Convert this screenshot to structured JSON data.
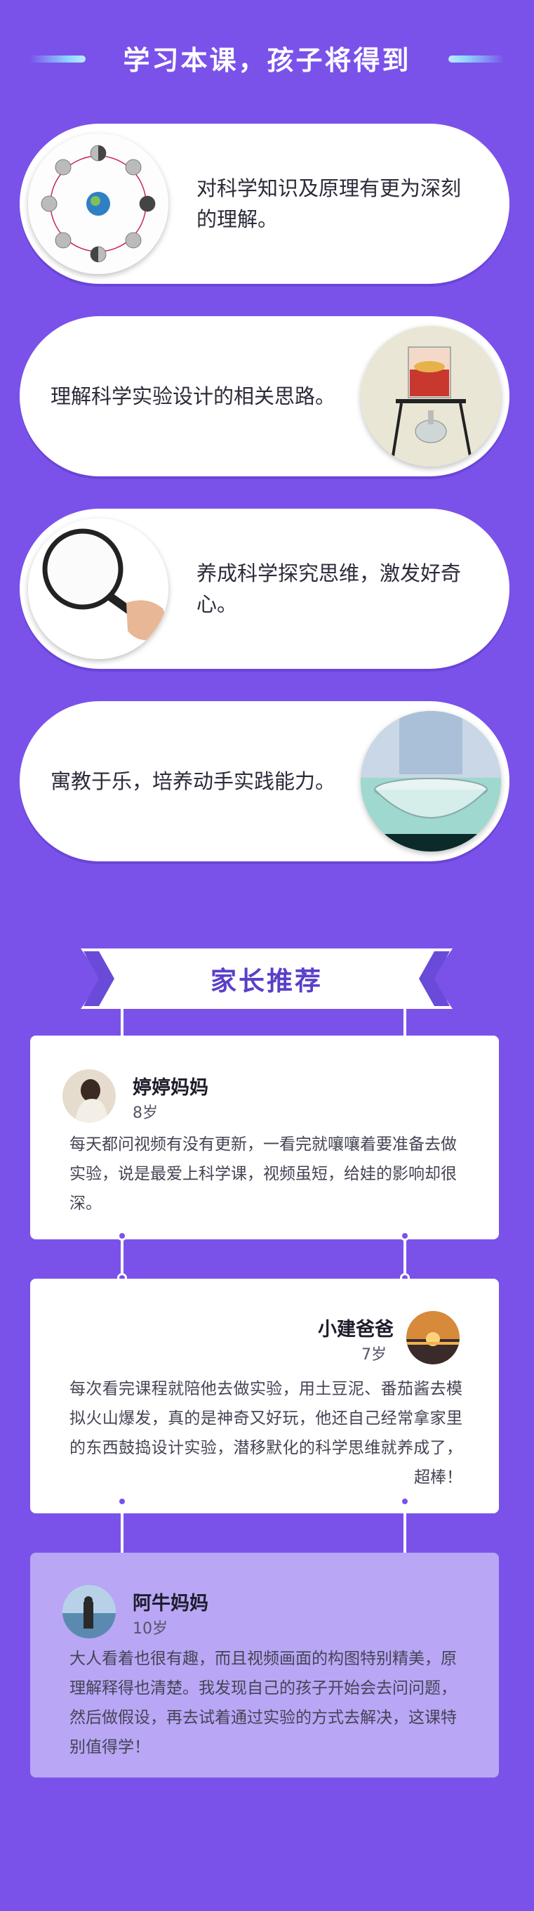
{
  "header": {
    "title": "学习本课，孩子将得到"
  },
  "benefits": [
    {
      "text": "对科学知识及原理有更为深刻的理解。",
      "icon": "moon-phases-diagram-image"
    },
    {
      "text": "理解科学实验设计的相关思路。",
      "icon": "beaker-experiment-image"
    },
    {
      "text": "养成科学探究思维，激发好奇心。",
      "icon": "magnifying-glass-image"
    },
    {
      "text": "寓教于乐，培养动手实践能力。",
      "icon": "glass-bowl-experiment-image"
    }
  ],
  "recommend": {
    "title": "家长推荐",
    "reviews": [
      {
        "name": "婷婷妈妈",
        "age": "8岁",
        "text": "每天都问视频有没有更新，一看完就嚷嚷着要准备去做实验，说是最爱上科学课，视频虽短，给娃的影响却很深。"
      },
      {
        "name": "小建爸爸",
        "age": "7岁",
        "text": "每次看完课程就陪他去做实验，用土豆泥、番茄酱去模拟火山爆发，真的是神奇又好玩，他还自己经常拿家里的东西鼓捣设计实验，潜移默化的科学思维就养成了，超棒！"
      },
      {
        "name": "阿牛妈妈",
        "age": "10岁",
        "text": "大人看着也很有趣，而且视频画面的构图特别精美，原理解释得也清楚。我发现自己的孩子开始会去问问题，然后做假设，再去试着通过实验的方式去解决，这课特别值得学！"
      }
    ]
  },
  "colors": {
    "background": "#7a52ea",
    "accent": "#5a3fc8",
    "card": "#ffffff",
    "card_faint": "#b9a6f5"
  }
}
